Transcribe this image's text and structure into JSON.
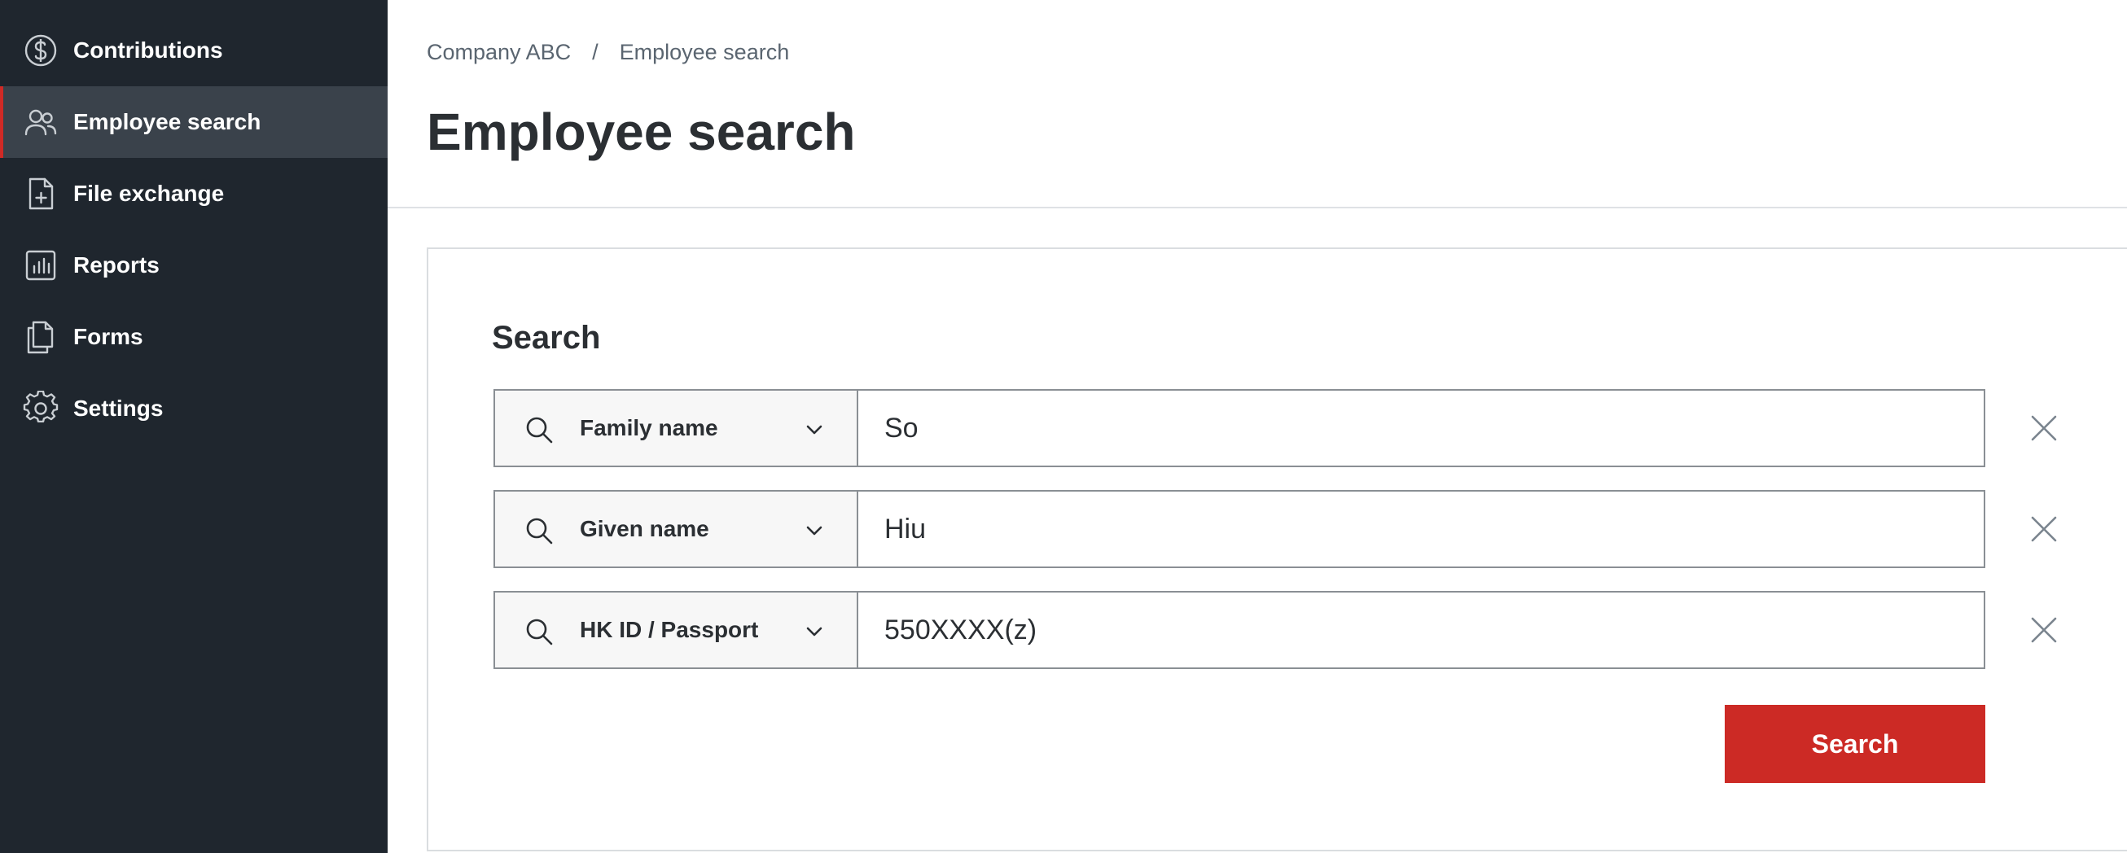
{
  "sidebar": {
    "items": [
      {
        "label": "Contributions",
        "icon": "dollar-circle-icon"
      },
      {
        "label": "Employee search",
        "icon": "users-icon",
        "active": true
      },
      {
        "label": "File exchange",
        "icon": "file-plus-icon"
      },
      {
        "label": "Reports",
        "icon": "bar-chart-icon"
      },
      {
        "label": "Forms",
        "icon": "documents-icon"
      },
      {
        "label": "Settings",
        "icon": "gear-icon"
      }
    ]
  },
  "breadcrumb": {
    "items": [
      "Company ABC",
      "Employee search"
    ],
    "separator": "/"
  },
  "page": {
    "title": "Employee search"
  },
  "search": {
    "title": "Search",
    "rows": [
      {
        "field": "Family name",
        "value": "So"
      },
      {
        "field": "Given name",
        "value": "Hiu"
      },
      {
        "field": "HK ID / Passport",
        "value": "550XXXX(z)"
      }
    ],
    "button_label": "Search"
  },
  "colors": {
    "sidebar_bg": "#1f262e",
    "sidebar_active_bg": "#3a424b",
    "accent": "#cc2a25",
    "text": "#2b2f33",
    "muted": "#5a6570"
  }
}
